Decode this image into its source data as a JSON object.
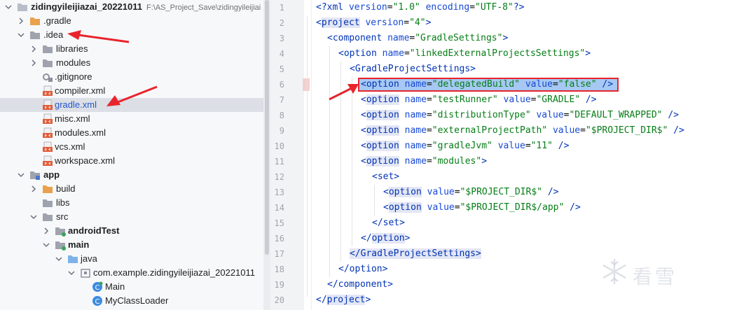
{
  "tree": {
    "rows": [
      {
        "label": "zidingyileijiazai_20221011",
        "path": "F:\\AS_Project_Save\\zidingyileijiai"
      },
      {
        "label": ".gradle"
      },
      {
        "label": ".idea"
      },
      {
        "label": "libraries"
      },
      {
        "label": "modules"
      },
      {
        "label": ".gitignore"
      },
      {
        "label": "compiler.xml"
      },
      {
        "label": "gradle.xml"
      },
      {
        "label": "misc.xml"
      },
      {
        "label": "modules.xml"
      },
      {
        "label": "vcs.xml"
      },
      {
        "label": "workspace.xml"
      },
      {
        "label": "app"
      },
      {
        "label": "build"
      },
      {
        "label": "libs"
      },
      {
        "label": "src"
      },
      {
        "label": "androidTest"
      },
      {
        "label": "main"
      },
      {
        "label": "java"
      },
      {
        "label": "com.example.zidingyileijiazai_20221011"
      },
      {
        "label": "Main"
      },
      {
        "label": "MyClassLoader"
      }
    ]
  },
  "editor": {
    "line_numbers": [
      "1",
      "2",
      "3",
      "4",
      "5",
      "6",
      "7",
      "8",
      "9",
      "10",
      "11",
      "12",
      "13",
      "14",
      "15",
      "16",
      "17",
      "18",
      "19",
      "20"
    ],
    "lines": [
      {
        "tokens": [
          {
            "t": "<?xml ",
            "c": "tag"
          },
          {
            "t": "version",
            "c": "attr"
          },
          {
            "t": "=",
            "c": "pun"
          },
          {
            "t": "\"1.0\"",
            "c": "val"
          },
          {
            "t": " ",
            "c": "pun"
          },
          {
            "t": "encoding",
            "c": "attr"
          },
          {
            "t": "=",
            "c": "pun"
          },
          {
            "t": "\"UTF-8\"",
            "c": "val"
          },
          {
            "t": "?>",
            "c": "tag"
          }
        ]
      },
      {
        "tokens": [
          {
            "t": "<",
            "c": "tag"
          },
          {
            "t": "project",
            "c": "tag hl-tag"
          },
          {
            "t": " ",
            "c": "pun"
          },
          {
            "t": "version",
            "c": "attr"
          },
          {
            "t": "=",
            "c": "pun"
          },
          {
            "t": "\"4\"",
            "c": "val"
          },
          {
            "t": ">",
            "c": "tag"
          }
        ]
      },
      {
        "tokens": [
          {
            "t": "<component ",
            "c": "tag"
          },
          {
            "t": "name",
            "c": "attr"
          },
          {
            "t": "=",
            "c": "pun"
          },
          {
            "t": "\"GradleSettings\"",
            "c": "val"
          },
          {
            "t": ">",
            "c": "tag"
          }
        ]
      },
      {
        "tokens": [
          {
            "t": "<option ",
            "c": "tag"
          },
          {
            "t": "name",
            "c": "attr"
          },
          {
            "t": "=",
            "c": "pun"
          },
          {
            "t": "\"linkedExternalProjectsSettings\"",
            "c": "val"
          },
          {
            "t": ">",
            "c": "tag"
          }
        ]
      },
      {
        "tokens": [
          {
            "t": "<GradleProjectSettings>",
            "c": "tag"
          }
        ]
      },
      {
        "tokens": [
          {
            "t": "<option ",
            "c": "tag"
          },
          {
            "t": "name",
            "c": "attr"
          },
          {
            "t": "=",
            "c": "pun"
          },
          {
            "t": "\"delegatedBuild\"",
            "c": "val"
          },
          {
            "t": " ",
            "c": "pun"
          },
          {
            "t": "value",
            "c": "attr"
          },
          {
            "t": "=",
            "c": "pun"
          },
          {
            "t": "\"false\"",
            "c": "val"
          },
          {
            "t": " />",
            "c": "tag"
          }
        ]
      },
      {
        "tokens": [
          {
            "t": "<",
            "c": "tag"
          },
          {
            "t": "option",
            "c": "tag hl-tag"
          },
          {
            "t": " ",
            "c": "pun"
          },
          {
            "t": "name",
            "c": "attr"
          },
          {
            "t": "=",
            "c": "pun"
          },
          {
            "t": "\"testRunner\"",
            "c": "val"
          },
          {
            "t": " ",
            "c": "pun"
          },
          {
            "t": "value",
            "c": "attr"
          },
          {
            "t": "=",
            "c": "pun"
          },
          {
            "t": "\"GRADLE\"",
            "c": "val"
          },
          {
            "t": " />",
            "c": "tag"
          }
        ]
      },
      {
        "tokens": [
          {
            "t": "<",
            "c": "tag"
          },
          {
            "t": "option",
            "c": "tag hl-tag"
          },
          {
            "t": " ",
            "c": "pun"
          },
          {
            "t": "name",
            "c": "attr"
          },
          {
            "t": "=",
            "c": "pun"
          },
          {
            "t": "\"distributionType\"",
            "c": "val"
          },
          {
            "t": " ",
            "c": "pun"
          },
          {
            "t": "value",
            "c": "attr"
          },
          {
            "t": "=",
            "c": "pun"
          },
          {
            "t": "\"DEFAULT_WRAPPED\"",
            "c": "val"
          },
          {
            "t": " />",
            "c": "tag"
          }
        ]
      },
      {
        "tokens": [
          {
            "t": "<",
            "c": "tag"
          },
          {
            "t": "option",
            "c": "tag hl-tag"
          },
          {
            "t": " ",
            "c": "pun"
          },
          {
            "t": "name",
            "c": "attr"
          },
          {
            "t": "=",
            "c": "pun"
          },
          {
            "t": "\"externalProjectPath\"",
            "c": "val"
          },
          {
            "t": " ",
            "c": "pun"
          },
          {
            "t": "value",
            "c": "attr"
          },
          {
            "t": "=",
            "c": "pun"
          },
          {
            "t": "\"$PROJECT_DIR$\"",
            "c": "val"
          },
          {
            "t": " />",
            "c": "tag"
          }
        ]
      },
      {
        "tokens": [
          {
            "t": "<",
            "c": "tag"
          },
          {
            "t": "option",
            "c": "tag hl-tag"
          },
          {
            "t": " ",
            "c": "pun"
          },
          {
            "t": "name",
            "c": "attr"
          },
          {
            "t": "=",
            "c": "pun"
          },
          {
            "t": "\"gradleJvm\"",
            "c": "val"
          },
          {
            "t": " ",
            "c": "pun"
          },
          {
            "t": "value",
            "c": "attr"
          },
          {
            "t": "=",
            "c": "pun"
          },
          {
            "t": "\"11\"",
            "c": "val"
          },
          {
            "t": " />",
            "c": "tag"
          }
        ]
      },
      {
        "tokens": [
          {
            "t": "<",
            "c": "tag"
          },
          {
            "t": "option",
            "c": "tag hl-tag"
          },
          {
            "t": " ",
            "c": "pun"
          },
          {
            "t": "name",
            "c": "attr"
          },
          {
            "t": "=",
            "c": "pun"
          },
          {
            "t": "\"modules\"",
            "c": "val"
          },
          {
            "t": ">",
            "c": "tag"
          }
        ]
      },
      {
        "tokens": [
          {
            "t": "<set>",
            "c": "tag"
          }
        ]
      },
      {
        "tokens": [
          {
            "t": "<",
            "c": "tag"
          },
          {
            "t": "option",
            "c": "tag hl-tag"
          },
          {
            "t": " ",
            "c": "pun"
          },
          {
            "t": "value",
            "c": "attr"
          },
          {
            "t": "=",
            "c": "pun"
          },
          {
            "t": "\"$PROJECT_DIR$\"",
            "c": "val"
          },
          {
            "t": " />",
            "c": "tag"
          }
        ]
      },
      {
        "tokens": [
          {
            "t": "<",
            "c": "tag"
          },
          {
            "t": "option",
            "c": "tag hl-tag"
          },
          {
            "t": " ",
            "c": "pun"
          },
          {
            "t": "value",
            "c": "attr"
          },
          {
            "t": "=",
            "c": "pun"
          },
          {
            "t": "\"$PROJECT_DIR$/app\"",
            "c": "val"
          },
          {
            "t": " />",
            "c": "tag"
          }
        ]
      },
      {
        "tokens": [
          {
            "t": "</set>",
            "c": "tag"
          }
        ]
      },
      {
        "tokens": [
          {
            "t": "</",
            "c": "tag"
          },
          {
            "t": "option",
            "c": "tag hl-tag"
          },
          {
            "t": ">",
            "c": "tag"
          }
        ]
      },
      {
        "tokens": [
          {
            "t": "</GradleProjectSettings>",
            "c": "tag hl-tag"
          }
        ]
      },
      {
        "tokens": [
          {
            "t": "</option>",
            "c": "tag"
          }
        ]
      },
      {
        "tokens": [
          {
            "t": "</component>",
            "c": "tag"
          }
        ]
      },
      {
        "tokens": [
          {
            "t": "</",
            "c": "tag"
          },
          {
            "t": "project",
            "c": "tag hl-tag"
          },
          {
            "t": ">",
            "c": "tag"
          }
        ]
      }
    ]
  },
  "watermark": {
    "text": "看雪"
  },
  "colors": {
    "tag": "#0033b3",
    "attr": "#174ad4",
    "value": "#067d17",
    "annotation": "#e8242c",
    "selection": "#a6c8f3"
  }
}
